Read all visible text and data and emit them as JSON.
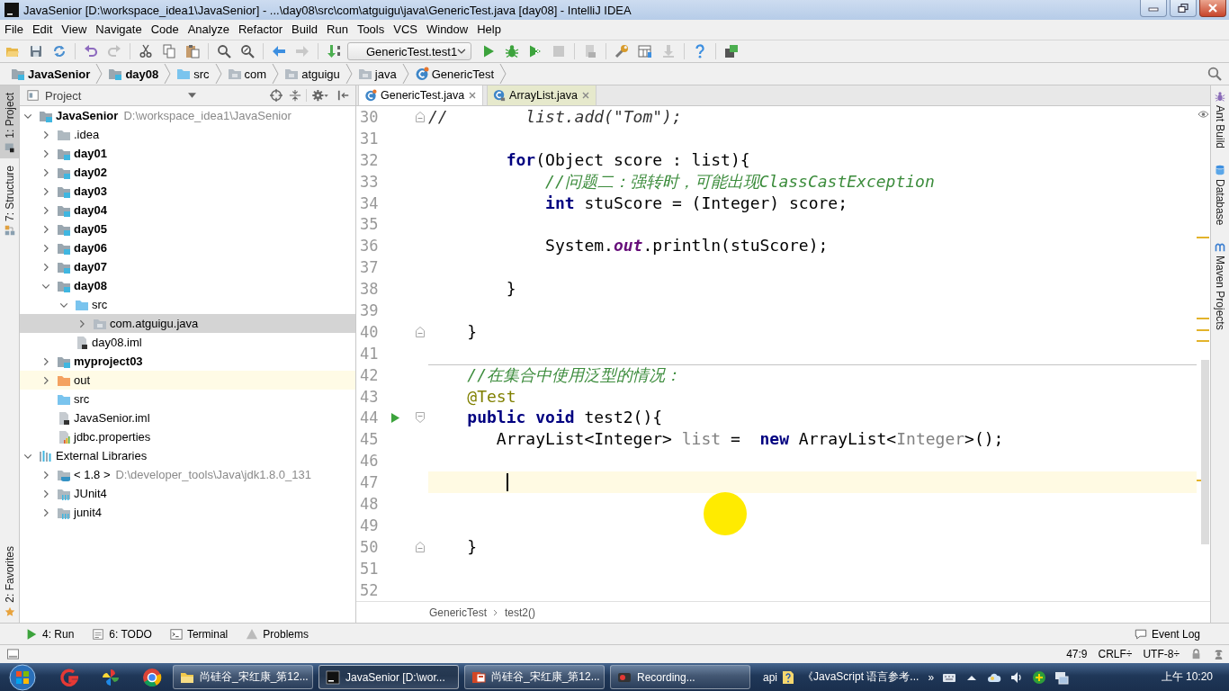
{
  "window": {
    "title": "JavaSenior [D:\\workspace_idea1\\JavaSenior] - ...\\day08\\src\\com\\atguigu\\java\\GenericTest.java [day08] - IntelliJ IDEA"
  },
  "menu": [
    "File",
    "Edit",
    "View",
    "Navigate",
    "Code",
    "Analyze",
    "Refactor",
    "Build",
    "Run",
    "Tools",
    "VCS",
    "Window",
    "Help"
  ],
  "toolbar": {
    "run_config": "GenericTest.test1"
  },
  "nav_bar": [
    {
      "label": "JavaSenior",
      "kind": "module"
    },
    {
      "label": "day08",
      "kind": "module"
    },
    {
      "label": "src",
      "kind": "source-folder"
    },
    {
      "label": "com",
      "kind": "package"
    },
    {
      "label": "atguigu",
      "kind": "package"
    },
    {
      "label": "java",
      "kind": "package"
    },
    {
      "label": "GenericTest",
      "kind": "class"
    }
  ],
  "left_tool_strip": {
    "top": [
      {
        "label": "1: Project",
        "kind": "project",
        "selected": true
      },
      {
        "label": "7: Structure",
        "kind": "structure",
        "selected": false
      }
    ],
    "bottom": [
      {
        "label": "2: Favorites",
        "kind": "favorites",
        "selected": false
      }
    ]
  },
  "project": {
    "title": "Project",
    "tree": [
      {
        "label": "JavaSenior",
        "kind": "module",
        "path": "D:\\workspace_idea1\\JavaSenior",
        "expanded": true,
        "selected": false,
        "children": [
          {
            "label": ".idea",
            "kind": "folder",
            "expanded": false,
            "selected": false
          },
          {
            "label": "day01",
            "kind": "module",
            "expanded": false,
            "selected": false
          },
          {
            "label": "day02",
            "kind": "module",
            "expanded": false,
            "selected": false
          },
          {
            "label": "day03",
            "kind": "module",
            "expanded": false,
            "selected": false
          },
          {
            "label": "day04",
            "kind": "module",
            "expanded": false,
            "selected": false
          },
          {
            "label": "day05",
            "kind": "module",
            "expanded": false,
            "selected": false
          },
          {
            "label": "day06",
            "kind": "module",
            "expanded": false,
            "selected": false
          },
          {
            "label": "day07",
            "kind": "module",
            "expanded": false,
            "selected": false
          },
          {
            "label": "day08",
            "kind": "module",
            "expanded": true,
            "selected": false,
            "children": [
              {
                "label": "src",
                "kind": "source-folder",
                "expanded": true,
                "selected": false,
                "children": [
                  {
                    "label": "com.atguigu.java",
                    "kind": "package",
                    "expanded": false,
                    "selected": true
                  }
                ]
              },
              {
                "label": "day08.iml",
                "kind": "iml",
                "selected": false
              }
            ]
          },
          {
            "label": "myproject03",
            "kind": "module",
            "expanded": false,
            "selected": false
          },
          {
            "label": "out",
            "kind": "excluded-folder",
            "expanded": false,
            "selected": false
          },
          {
            "label": "src",
            "kind": "source-folder",
            "selected": false
          },
          {
            "label": "JavaSenior.iml",
            "kind": "iml",
            "selected": false
          },
          {
            "label": "jdbc.properties",
            "kind": "properties",
            "selected": false
          }
        ]
      },
      {
        "label": "External Libraries",
        "kind": "libraries",
        "expanded": true,
        "selected": false,
        "children": [
          {
            "label": "< 1.8 >",
            "kind": "jdk",
            "path": "D:\\developer_tools\\Java\\jdk1.8.0_131",
            "expanded": false,
            "selected": false
          },
          {
            "label": "JUnit4",
            "kind": "library",
            "expanded": false,
            "selected": false
          },
          {
            "label": "junit4",
            "kind": "library",
            "expanded": false,
            "selected": false
          }
        ]
      }
    ]
  },
  "editor": {
    "tabs": [
      {
        "label": "GenericTest.java",
        "kind": "class",
        "selected": true
      },
      {
        "label": "ArrayList.java",
        "kind": "library-class",
        "selected": false
      }
    ],
    "lines": [
      {
        "number": "30",
        "fold_end": true,
        "tokens": [
          {
            "kind": "commented-code",
            "text": "//        list.add(\"Tom\");"
          }
        ]
      },
      {
        "number": "31"
      },
      {
        "number": "32",
        "tokens": [
          {
            "kind": "keyword",
            "text": "        for"
          },
          {
            "kind": "plain",
            "text": "(Object score : list){"
          }
        ]
      },
      {
        "number": "33",
        "tokens": [
          {
            "kind": "comment",
            "text": "            //问题二：强转时，可能出现ClassCastException"
          }
        ]
      },
      {
        "number": "34",
        "tokens": [
          {
            "kind": "keyword",
            "text": "            int"
          },
          {
            "kind": "plain",
            "text": " stuScore = (Integer) score;"
          }
        ]
      },
      {
        "number": "35"
      },
      {
        "number": "36",
        "tokens": [
          {
            "kind": "plain",
            "text": "            System."
          },
          {
            "kind": "field",
            "text": "out"
          },
          {
            "kind": "plain",
            "text": ".println(stuScore);"
          }
        ]
      },
      {
        "number": "37"
      },
      {
        "number": "38",
        "tokens": [
          {
            "kind": "plain",
            "text": "        }"
          }
        ]
      },
      {
        "number": "39"
      },
      {
        "number": "40",
        "fold_end": true,
        "tokens": [
          {
            "kind": "plain",
            "text": "    }"
          }
        ]
      },
      {
        "number": "41"
      },
      {
        "number": "42",
        "separator": true,
        "tokens": [
          {
            "kind": "comment",
            "text": "    //在集合中使用泛型的情况："
          }
        ]
      },
      {
        "number": "43",
        "tokens": [
          {
            "kind": "annotation",
            "text": "    @Test"
          }
        ]
      },
      {
        "number": "44",
        "run_marker": true,
        "fold_start": true,
        "tokens": [
          {
            "kind": "keyword",
            "text": "    public void"
          },
          {
            "kind": "plain",
            "text": " test2(){"
          }
        ]
      },
      {
        "number": "45",
        "tokens": [
          {
            "kind": "plain",
            "text": "       ArrayList<Integer> "
          },
          {
            "kind": "dimmed",
            "text": "list"
          },
          {
            "kind": "plain",
            "text": " =  "
          },
          {
            "kind": "keyword",
            "text": "new"
          },
          {
            "kind": "plain",
            "text": " ArrayList<"
          },
          {
            "kind": "dimmed",
            "text": "Integer"
          },
          {
            "kind": "plain",
            "text": ">();"
          }
        ]
      },
      {
        "number": "46"
      },
      {
        "number": "47",
        "current": true,
        "caret": true
      },
      {
        "number": "48"
      },
      {
        "number": "49"
      },
      {
        "number": "50",
        "fold_end": true,
        "tokens": [
          {
            "kind": "plain",
            "text": "    }"
          }
        ]
      },
      {
        "number": "51"
      },
      {
        "number": "52"
      }
    ],
    "breadcrumb": [
      "GenericTest",
      "test2()"
    ]
  },
  "right_tool_strip": [
    {
      "label": "Ant Build",
      "kind": "ant"
    },
    {
      "label": "Database",
      "kind": "database"
    },
    {
      "label": "Maven Projects",
      "kind": "maven"
    }
  ],
  "bottom_tool_bar": {
    "left": [
      {
        "label": "4: Run",
        "kind": "run"
      },
      {
        "label": "6: TODO",
        "kind": "todo"
      },
      {
        "label": "Terminal",
        "kind": "terminal"
      },
      {
        "label": "Problems",
        "kind": "problems"
      }
    ],
    "right": [
      {
        "label": "Event Log",
        "kind": "event-log"
      }
    ]
  },
  "status_bar": {
    "position": "47:9",
    "line_separator": "CRLF÷",
    "encoding": "UTF-8÷"
  },
  "taskbar": {
    "tasks": [
      {
        "label": "尚硅谷_宋红康_第12...",
        "kind": "folder",
        "selected": false
      },
      {
        "label": "JavaSenior [D:\\wor...",
        "kind": "ide",
        "selected": true
      },
      {
        "label": "尚硅谷_宋红康_第12...",
        "kind": "slides",
        "selected": false
      },
      {
        "label": "Recording...",
        "kind": "recorder",
        "selected": false
      }
    ],
    "links": [
      {
        "label": "api",
        "kind": "plain"
      },
      {
        "label": "《JavaScript 语言参考...",
        "kind": "help-doc"
      }
    ],
    "overflow": "»",
    "clock": "上午 10:20"
  }
}
